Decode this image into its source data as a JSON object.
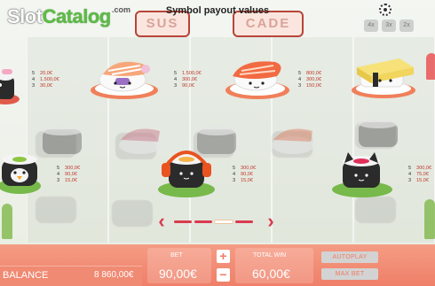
{
  "header": {
    "logo_part1": "Slot",
    "logo_part2": "Catalog",
    "logo_suffix": ".com",
    "title": "Symbol payout values",
    "sign_left": "SUS",
    "sign_right": "CADE",
    "mini_buttons": [
      "4x",
      "3x",
      "2x"
    ]
  },
  "symbols": [
    {
      "name": "nigiri-shrimp",
      "payouts": [
        {
          "count": "5",
          "value": "20,0€"
        },
        {
          "count": "4",
          "value": "1.500,0€"
        },
        {
          "count": "3",
          "value": "30,0€"
        }
      ]
    },
    {
      "name": "nigiri-salmon",
      "payouts": [
        {
          "count": "5",
          "value": "1.500,0€"
        },
        {
          "count": "4",
          "value": "300,0€"
        },
        {
          "count": "3",
          "value": "90,0€"
        }
      ]
    },
    {
      "name": "tamago",
      "payouts": [
        {
          "count": "5",
          "value": "800,0€"
        },
        {
          "count": "4",
          "value": "300,0€"
        },
        {
          "count": "3",
          "value": "150,0€"
        }
      ]
    },
    {
      "name": "maki-penguin",
      "payouts": [
        {
          "count": "5",
          "value": "300,0€"
        },
        {
          "count": "4",
          "value": "90,0€"
        },
        {
          "count": "3",
          "value": "15,0€"
        }
      ]
    },
    {
      "name": "maki-headphones",
      "payouts": [
        {
          "count": "5",
          "value": "300,0€"
        },
        {
          "count": "4",
          "value": "90,0€"
        },
        {
          "count": "3",
          "value": "15,0€"
        }
      ]
    },
    {
      "name": "maki-cat",
      "payouts": [
        {
          "count": "5",
          "value": "300,0€"
        },
        {
          "count": "4",
          "value": "75,0€"
        },
        {
          "count": "3",
          "value": "15,0€"
        }
      ]
    }
  ],
  "pager": {
    "pages": 4,
    "current_page": 3
  },
  "bottom": {
    "balance_label": "BALANCE",
    "balance_value": "8 860,00€",
    "bet_label": "BET",
    "bet_value": "90,00€",
    "plus": "+",
    "minus": "−",
    "win_label": "TOTAL WIN",
    "win_value": "60,00€",
    "autoplay": "AUTOPLAY",
    "maxbet": "MAX BET"
  },
  "colors": {
    "bar": "#ef8a72",
    "payout_value": "#c0392b",
    "arrow": "#d93a4e",
    "logo_green": "#5dbb46"
  }
}
